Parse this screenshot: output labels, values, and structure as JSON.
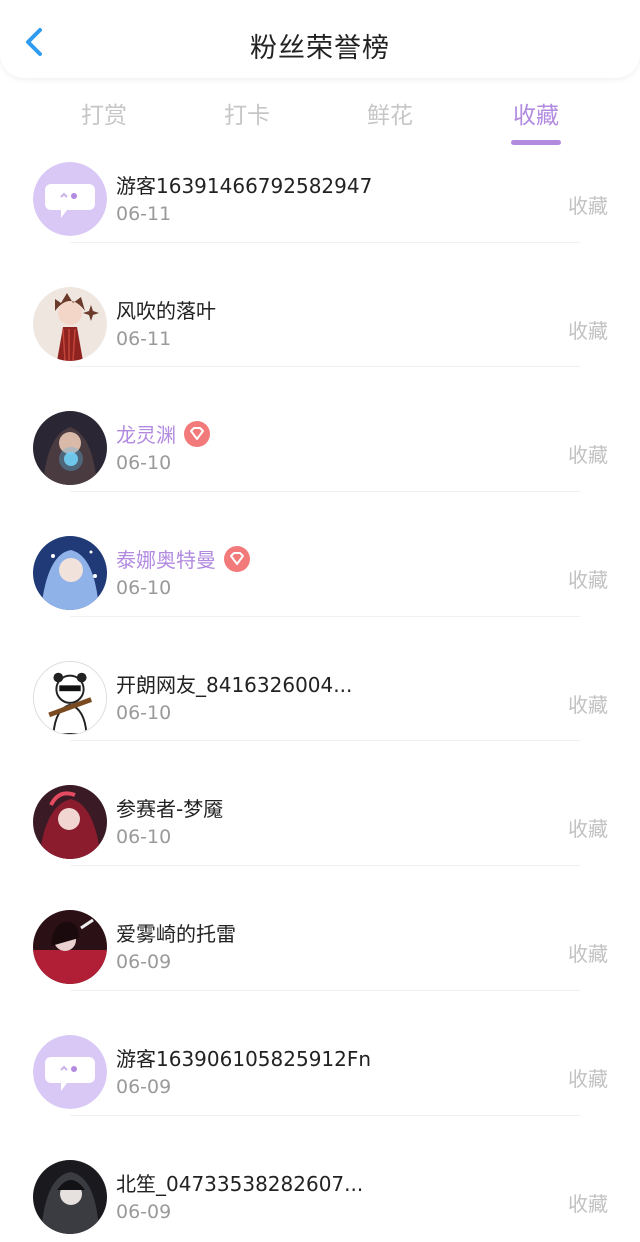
{
  "header": {
    "title": "粉丝荣誉榜",
    "back_icon": "chevron-left-icon",
    "accent": "#2f9cf0"
  },
  "tabs": [
    {
      "label": "打赏",
      "active": false
    },
    {
      "label": "打卡",
      "active": false
    },
    {
      "label": "鲜花",
      "active": false
    },
    {
      "label": "收藏",
      "active": true
    }
  ],
  "colors": {
    "accent": "#b28be0",
    "badge": "#f27a7a"
  },
  "list": [
    {
      "name": "游客163914667925829​47",
      "date": "06-11",
      "action": "收藏",
      "avatar": "default-chat-avatar",
      "vip": false
    },
    {
      "name": "风吹的落叶",
      "date": "06-11",
      "action": "收藏",
      "avatar": "anime-girl-avatar",
      "vip": false
    },
    {
      "name": "龙灵渊",
      "date": "06-10",
      "action": "收藏",
      "avatar": "dark-anime-avatar",
      "vip": true,
      "badge_icon": "diamond-badge-icon"
    },
    {
      "name": "泰娜奥特曼",
      "date": "06-10",
      "action": "收藏",
      "avatar": "blue-anime-avatar",
      "vip": true,
      "badge_icon": "diamond-badge-icon"
    },
    {
      "name": "开朗网友_8416326004...",
      "date": "06-10",
      "action": "收藏",
      "avatar": "panda-meme-avatar",
      "vip": false
    },
    {
      "name": "参赛者-梦魇",
      "date": "06-10",
      "action": "收藏",
      "avatar": "red-anime-avatar",
      "vip": false
    },
    {
      "name": "爱雾崎的托雷",
      "date": "06-09",
      "action": "收藏",
      "avatar": "crimson-anime-avatar",
      "vip": false
    },
    {
      "name": "游客163906105825912Fn",
      "date": "06-09",
      "action": "收藏",
      "avatar": "default-chat-avatar",
      "vip": false
    },
    {
      "name": "北笙_04733538282607...",
      "date": "06-09",
      "action": "收藏",
      "avatar": "dark-girl-avatar",
      "vip": false
    }
  ]
}
